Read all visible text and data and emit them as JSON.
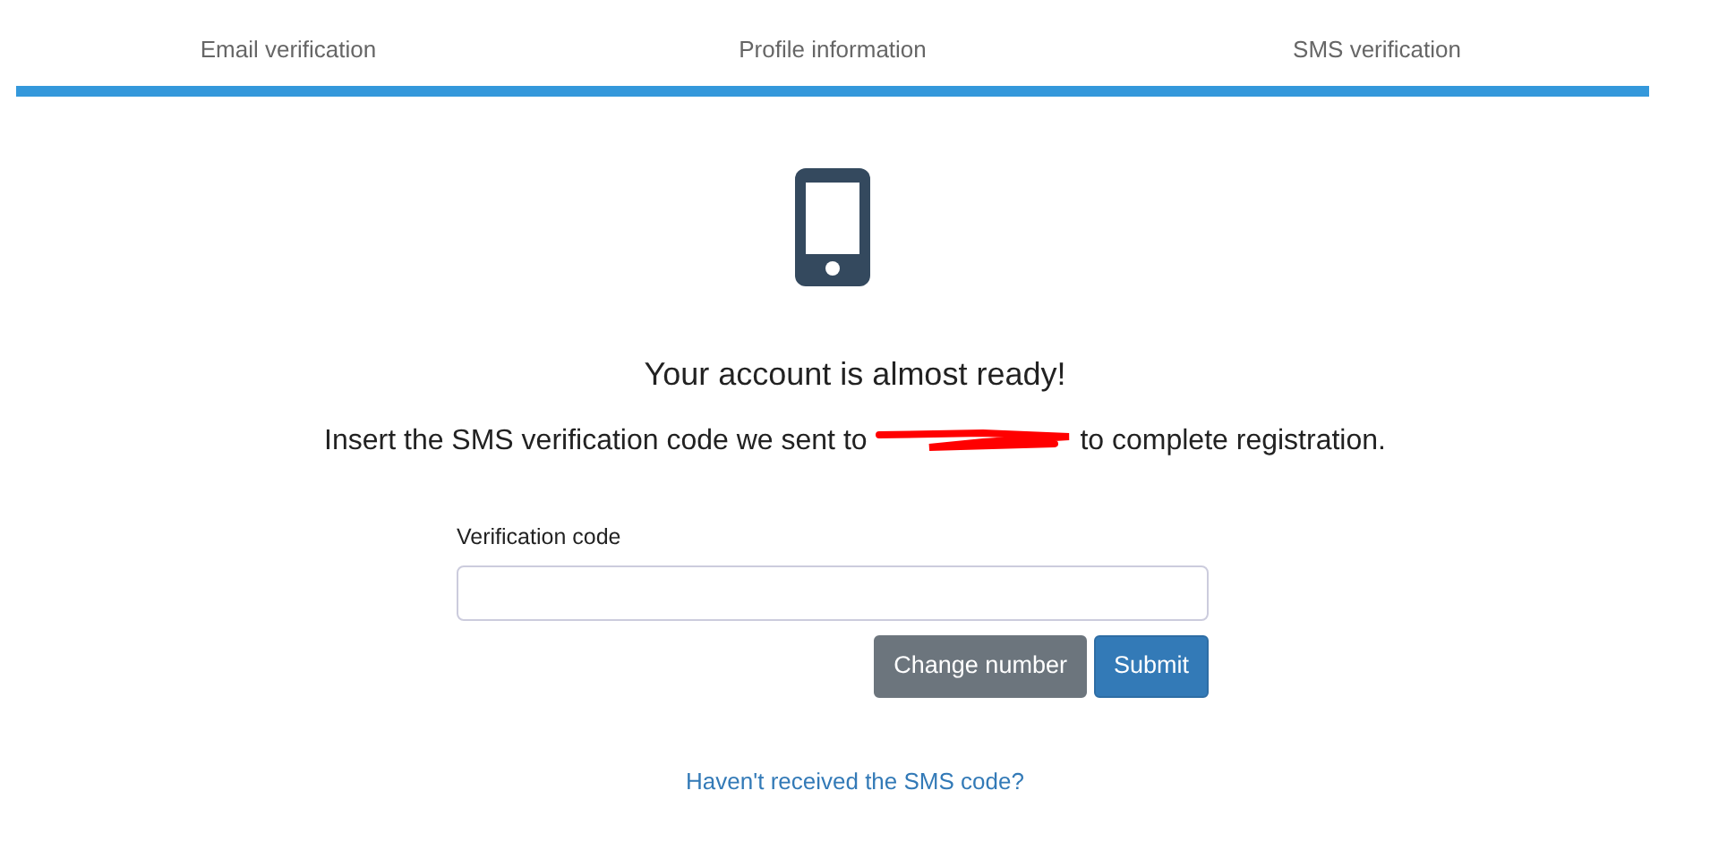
{
  "steps": [
    {
      "label": "Email verification"
    },
    {
      "label": "Profile information"
    },
    {
      "label": "SMS verification"
    }
  ],
  "progress": {
    "level": 1
  },
  "heading": "Your account is almost ready!",
  "message": {
    "before": "Insert the SMS verification code we sent to",
    "redacted": true,
    "after": "to complete registration."
  },
  "form": {
    "label": "Verification code"
  },
  "buttons": [
    {
      "label": "Change number",
      "kind": "secondary"
    },
    {
      "label": "Submit",
      "kind": "primary"
    }
  ],
  "help_link": "Haven't received the SMS code?"
}
